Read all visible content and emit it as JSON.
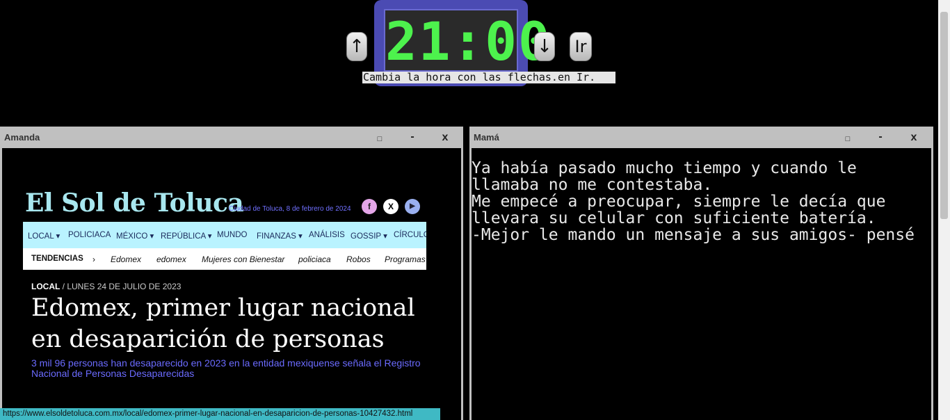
{
  "clock": {
    "time": "21:00",
    "up_label": "↑",
    "down_label": "↓",
    "go_label": "Ir",
    "hint": "Cambia la hora con las flechas.en Ir."
  },
  "left_window": {
    "title": "Amanda",
    "max_label": "□",
    "min_label": "-",
    "close_label": "x",
    "page": {
      "logo": "El Sol de Toluca",
      "dateline": "Ciudad de Toluca, 8 de febrero de 2024",
      "social": [
        "f",
        "X",
        "▶"
      ],
      "nav": [
        "LOCAL ▾",
        "POLICIACA",
        "MÉXICO ▾",
        "REPÚBLICA ▾",
        "MUNDO",
        "FINANZAS ▾",
        "ANÁLISIS",
        "GOSSIP ▾",
        "CÍRCULO"
      ],
      "trends_label": "TENDENCIAS",
      "trends_sep": "›",
      "trends": [
        "Edomex",
        "edomex",
        "Mujeres con Bienestar",
        "policiaca",
        "Robos",
        "Programas"
      ],
      "section": "LOCAL",
      "article_date": "/ LUNES 24 DE JULIO DE 2023",
      "headline": "Edomex, primer lugar nacional en desaparición de personas",
      "summary": "3 mil 96 personas han desaparecido en 2023 en la entidad mexiquense señala el Registro Nacional de Personas Desaparecidas"
    }
  },
  "right_window": {
    "title": "Mamá",
    "max_label": "□",
    "min_label": "-",
    "close_label": "x",
    "story": "Ya había pasado mucho tiempo y cuando le llamaba no me contestaba.\nMe empecé a preocupar, siempre le decía que llevara su celular con suficiente batería.\n-Mejor le mando un mensaje a sus amigos- pensé"
  },
  "status_url": "https://www.elsoldetoluca.com.mx/local/edomex-primer-lugar-nacional-en-desaparicion-de-personas-10427432.html"
}
